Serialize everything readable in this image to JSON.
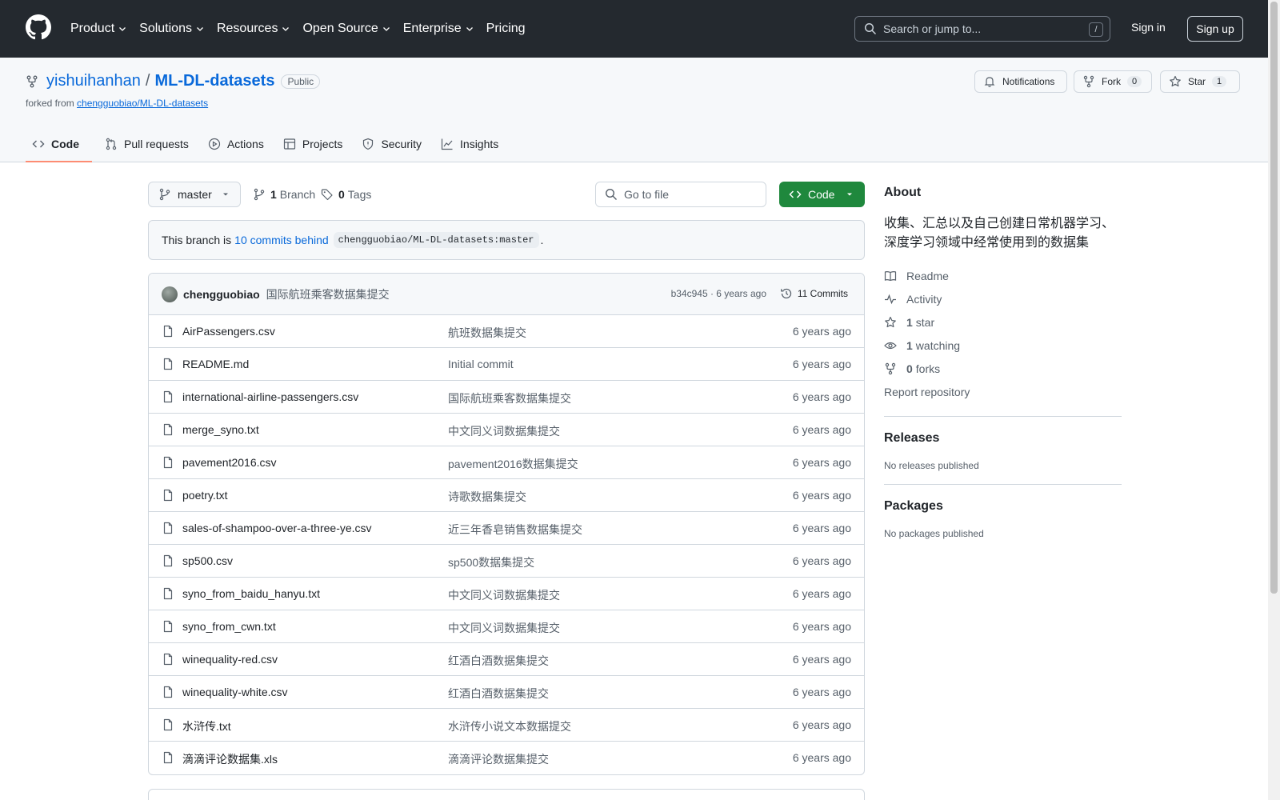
{
  "header": {
    "nav": [
      "Product",
      "Solutions",
      "Resources",
      "Open Source",
      "Enterprise",
      "Pricing"
    ],
    "search_placeholder": "Search or jump to...",
    "search_shortcut": "/",
    "signin": "Sign in",
    "signup": "Sign up"
  },
  "repo": {
    "owner": "yishuihanhan",
    "separator": "/",
    "name": "ML-DL-datasets",
    "visibility": "Public",
    "forked_prefix": "forked from",
    "forked_from": "chengguobiao/ML-DL-datasets",
    "notifications": "Notifications",
    "fork_label": "Fork",
    "fork_count": "0",
    "star_label": "Star",
    "star_count": "1"
  },
  "tabs": [
    "Code",
    "Pull requests",
    "Actions",
    "Projects",
    "Security",
    "Insights"
  ],
  "toolbar": {
    "branch": "master",
    "branch_count": "1",
    "branch_label": "Branch",
    "tag_count": "0",
    "tag_label": "Tags",
    "goto_placeholder": "Go to file",
    "code_button": "Code"
  },
  "behind": {
    "prefix": "This branch is",
    "link": "10 commits behind",
    "ref": "chengguobiao/ML-DL-datasets:master",
    "suffix": "."
  },
  "last_commit": {
    "author": "chengguobiao",
    "message": "国际航班乘客数据集提交",
    "meta": "b34c945 · 6 years ago",
    "count": "11 Commits"
  },
  "files": [
    {
      "name": "AirPassengers.csv",
      "message": "航班数据集提交",
      "date": "6 years ago"
    },
    {
      "name": "README.md",
      "message": "Initial commit",
      "date": "6 years ago"
    },
    {
      "name": "international-airline-passengers.csv",
      "message": "国际航班乘客数据集提交",
      "date": "6 years ago"
    },
    {
      "name": "merge_syno.txt",
      "message": "中文同义词数据集提交",
      "date": "6 years ago"
    },
    {
      "name": "pavement2016.csv",
      "message": "pavement2016数据集提交",
      "date": "6 years ago"
    },
    {
      "name": "poetry.txt",
      "message": "诗歌数据集提交",
      "date": "6 years ago"
    },
    {
      "name": "sales-of-shampoo-over-a-three-ye.csv",
      "message": "近三年香皂销售数据集提交",
      "date": "6 years ago"
    },
    {
      "name": "sp500.csv",
      "message": "sp500数据集提交",
      "date": "6 years ago"
    },
    {
      "name": "syno_from_baidu_hanyu.txt",
      "message": "中文同义词数据集提交",
      "date": "6 years ago"
    },
    {
      "name": "syno_from_cwn.txt",
      "message": "中文同义词数据集提交",
      "date": "6 years ago"
    },
    {
      "name": "winequality-red.csv",
      "message": "红酒白酒数据集提交",
      "date": "6 years ago"
    },
    {
      "name": "winequality-white.csv",
      "message": "红酒白酒数据集提交",
      "date": "6 years ago"
    },
    {
      "name": "水浒传.txt",
      "message": "水浒传小说文本数据提交",
      "date": "6 years ago"
    },
    {
      "name": "滴滴评论数据集.xls",
      "message": "滴滴评论数据集提交",
      "date": "6 years ago"
    }
  ],
  "about": {
    "heading": "About",
    "description": "收集、汇总以及自己创建日常机器学习、深度学习领域中经常使用到的数据集",
    "readme": "Readme",
    "activity": "Activity",
    "stars_count": "1",
    "stars_label": "star",
    "watching_count": "1",
    "watching_label": "watching",
    "forks_count": "0",
    "forks_label": "forks",
    "report": "Report repository"
  },
  "releases": {
    "heading": "Releases",
    "empty": "No releases published"
  },
  "packages": {
    "heading": "Packages",
    "empty": "No packages published"
  },
  "colors": {
    "header_bg": "#24292f",
    "link": "#0969da",
    "code_button": "#1f883d",
    "tab_underline": "#fd8c73"
  }
}
